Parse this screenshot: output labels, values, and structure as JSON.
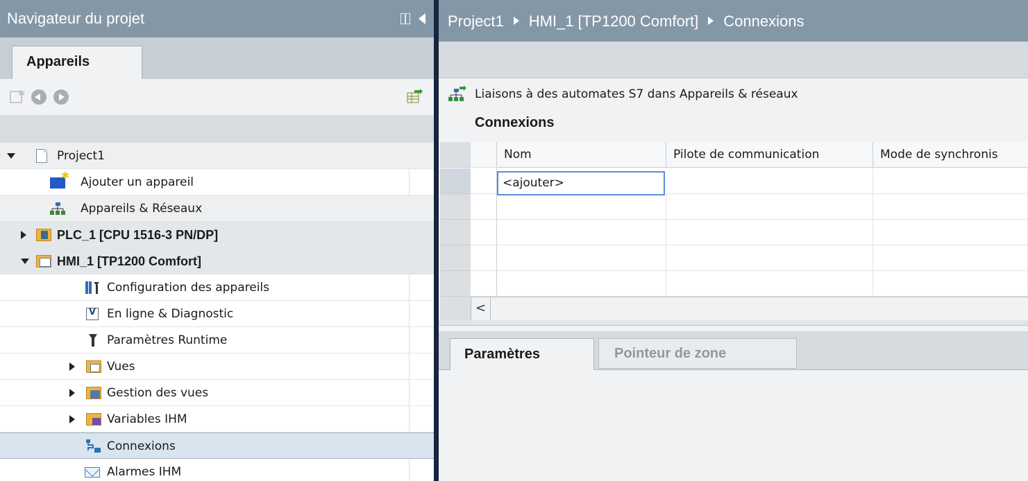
{
  "navigator": {
    "title": "Navigateur du projet",
    "tab": "Appareils",
    "tree": [
      {
        "label": "Project1",
        "level": 0,
        "expand": "down",
        "icon": "project-icon",
        "bold": false
      },
      {
        "label": "Ajouter un appareil",
        "level": 1,
        "expand": "",
        "icon": "add-device-icon",
        "bold": false
      },
      {
        "label": "Appareils & Réseaux",
        "level": 1,
        "expand": "",
        "icon": "network-icon",
        "bold": false
      },
      {
        "label": "PLC_1 [CPU 1516-3 PN/DP]",
        "level": 1,
        "expand": "right",
        "icon": "plc-icon",
        "bold": true
      },
      {
        "label": "HMI_1 [TP1200 Comfort]",
        "level": 1,
        "expand": "down",
        "icon": "hmi-icon",
        "bold": true
      },
      {
        "label": "Configuration des appareils",
        "level": 2,
        "expand": "",
        "icon": "device-config-icon",
        "bold": false
      },
      {
        "label": "En ligne & Diagnostic",
        "level": 2,
        "expand": "",
        "icon": "diagnostic-icon",
        "bold": false
      },
      {
        "label": "Paramètres Runtime",
        "level": 2,
        "expand": "",
        "icon": "wrench-icon",
        "bold": false
      },
      {
        "label": "Vues",
        "level": 2,
        "expand": "right",
        "icon": "folder-icon",
        "bold": false
      },
      {
        "label": "Gestion des vues",
        "level": 2,
        "expand": "right",
        "icon": "screen-management-icon",
        "bold": false
      },
      {
        "label": "Variables IHM",
        "level": 2,
        "expand": "right",
        "icon": "hmi-tags-icon",
        "bold": false
      },
      {
        "label": "Connexions",
        "level": 2,
        "expand": "",
        "icon": "connections-icon",
        "bold": false,
        "selected": true
      },
      {
        "label": "Alarmes IHM",
        "level": 2,
        "expand": "",
        "icon": "alarm-mail-icon",
        "bold": false
      }
    ]
  },
  "editor": {
    "breadcrumb": [
      "Project1",
      "HMI_1 [TP1200 Comfort]",
      "Connexions"
    ],
    "link_text": "Liaisons à des automates S7 dans Appareils & réseaux",
    "section_title": "Connexions",
    "columns": [
      "Nom",
      "Pilote de communication",
      "Mode de synchronis"
    ],
    "add_placeholder": "<ajouter>",
    "scroll_left": "<",
    "tabs": [
      "Paramètres",
      "Pointeur de zone"
    ]
  },
  "colors": {
    "title_bar": "#8397a7",
    "divider": "#17253d",
    "selection": "#d9e4ee",
    "cell_focus": "#5b8fd6"
  }
}
